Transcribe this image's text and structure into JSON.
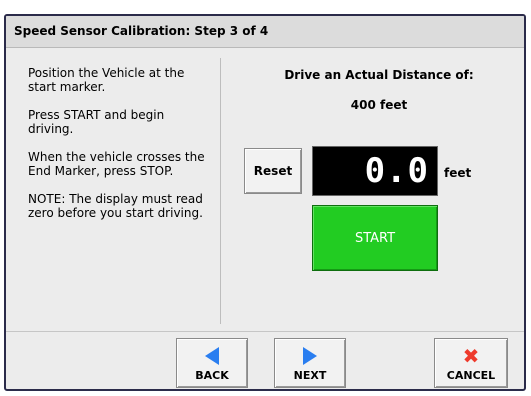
{
  "window": {
    "title": "Speed Sensor Calibration:  Step 3 of 4"
  },
  "instructions": [
    "Position the Vehicle at the start marker.",
    "Press START and begin driving.",
    "When the vehicle crosses the End Marker, press STOP.",
    "NOTE:  The display must read zero before you start driving."
  ],
  "target": {
    "label": "Drive an Actual Distance of:",
    "distance": "400 feet"
  },
  "controls": {
    "reset_label": "Reset",
    "display_value": "0.0",
    "unit": "feet",
    "start_label": "START",
    "start_color": "#22cc22"
  },
  "nav": {
    "back_label": "BACK",
    "back_icon": "left-arrow-icon",
    "next_label": "NEXT",
    "next_icon": "right-arrow-icon",
    "cancel_label": "CANCEL",
    "cancel_icon": "x-icon",
    "arrow_color": "#2a7ef0",
    "cancel_color": "#ee3a2c"
  }
}
